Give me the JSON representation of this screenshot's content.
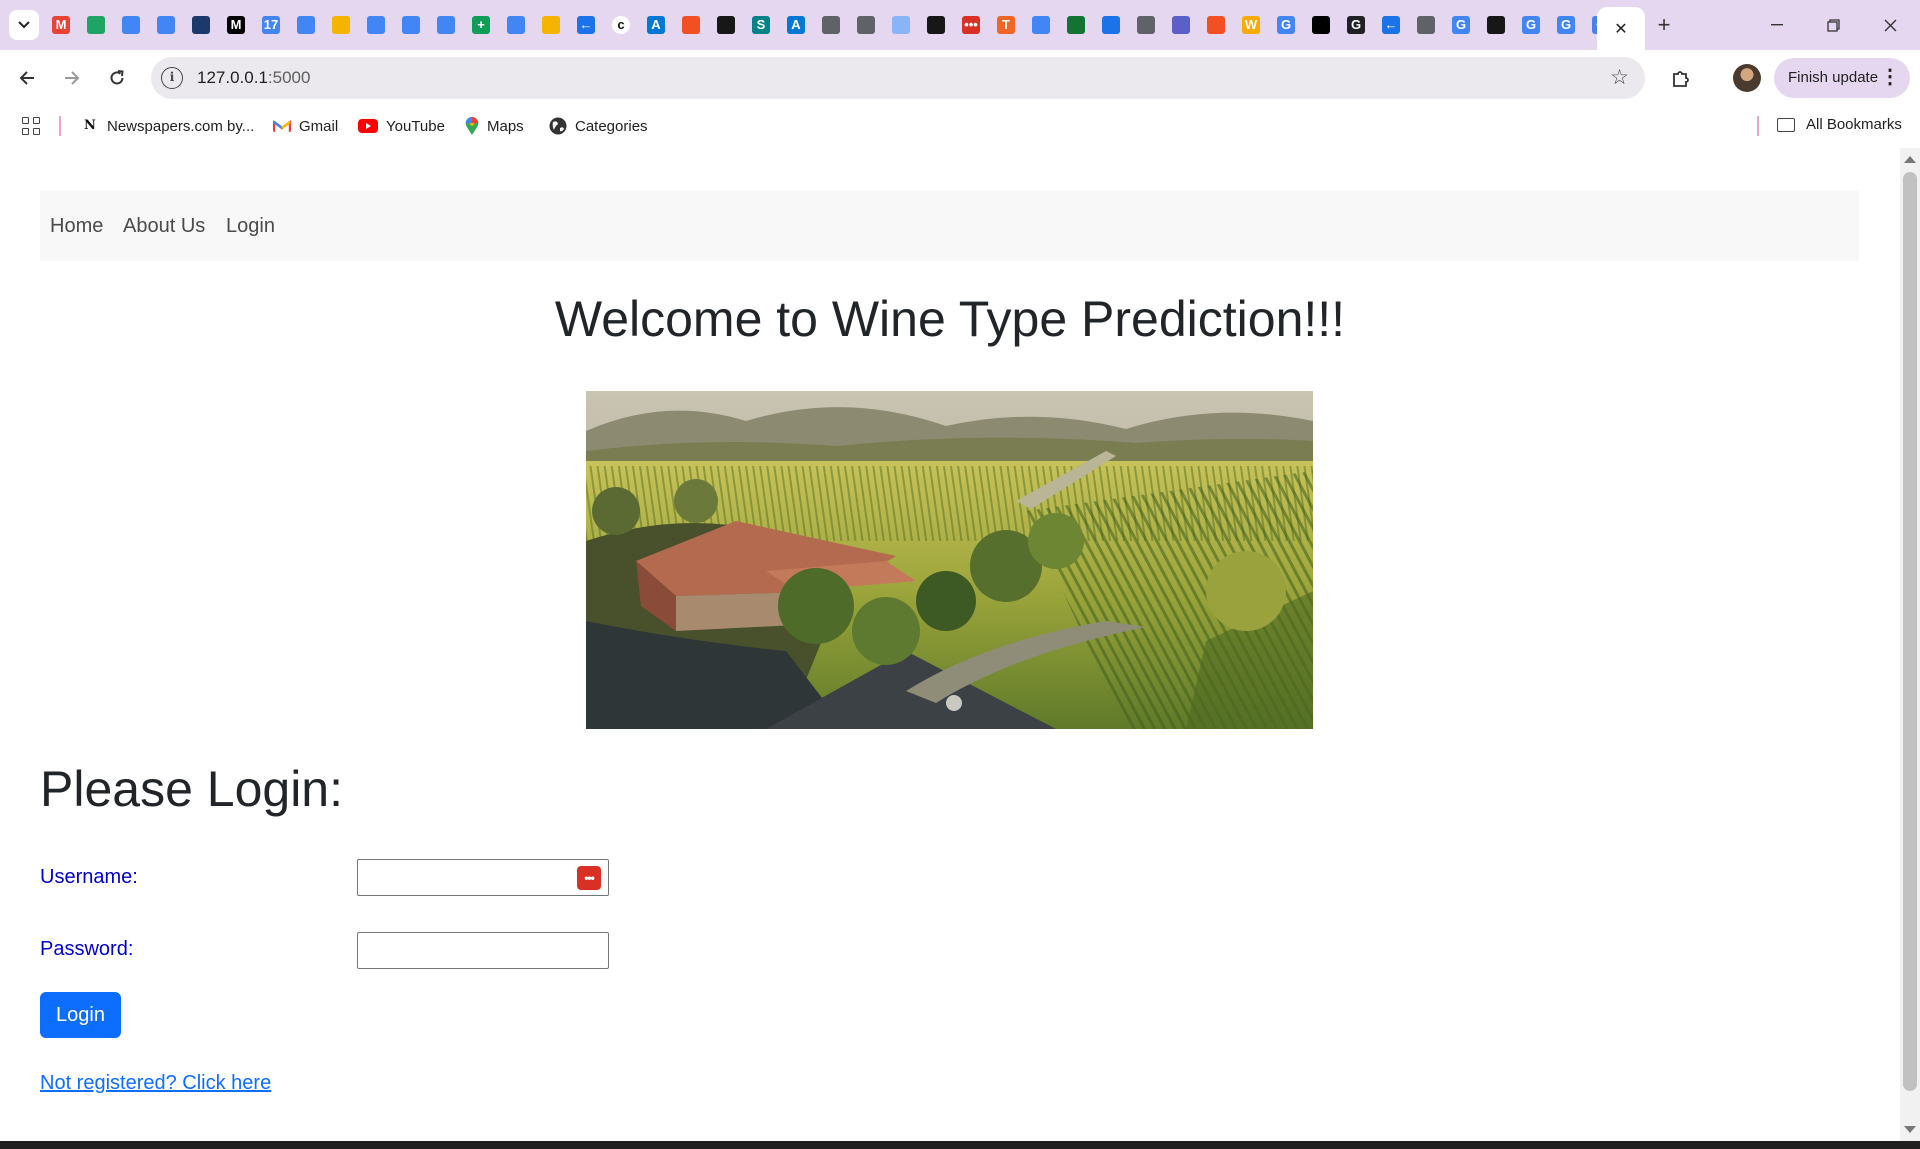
{
  "browser": {
    "tab_icons": [
      {
        "name": "gmail-favicon",
        "color": "#ea4335",
        "glyph": "M"
      },
      {
        "name": "google-drive-favicon",
        "color": "#1fa463",
        "glyph": ""
      },
      {
        "name": "google-docs-favicon",
        "color": "#4285f4",
        "glyph": ""
      },
      {
        "name": "google-docs-favicon",
        "color": "#4285f4",
        "glyph": ""
      },
      {
        "name": "chat-favicon",
        "color": "#1b3a6b",
        "glyph": ""
      },
      {
        "name": "medium-favicon",
        "color": "#000000",
        "glyph": "M"
      },
      {
        "name": "google-calendar-favicon",
        "color": "#4285f4",
        "glyph": "17"
      },
      {
        "name": "google-docs-favicon",
        "color": "#4285f4",
        "glyph": ""
      },
      {
        "name": "google-slides-favicon",
        "color": "#f4b400",
        "glyph": ""
      },
      {
        "name": "google-docs-favicon",
        "color": "#4285f4",
        "glyph": ""
      },
      {
        "name": "google-docs-favicon",
        "color": "#4285f4",
        "glyph": ""
      },
      {
        "name": "google-docs-favicon",
        "color": "#4285f4",
        "glyph": ""
      },
      {
        "name": "google-sheets-favicon",
        "color": "#0f9d58",
        "glyph": "+"
      },
      {
        "name": "google-docs-favicon",
        "color": "#4285f4",
        "glyph": ""
      },
      {
        "name": "google-slides-favicon",
        "color": "#f4b400",
        "glyph": ""
      },
      {
        "name": "arrow-favicon",
        "color": "#1a73e8",
        "glyph": "←"
      },
      {
        "name": "c-favicon",
        "color": "#ffffff",
        "glyph": "c"
      },
      {
        "name": "azure-favicon",
        "color": "#0078d4",
        "glyph": "A"
      },
      {
        "name": "microsoft-favicon",
        "color": "#f25022",
        "glyph": ""
      },
      {
        "name": "github-favicon",
        "color": "#181717",
        "glyph": ""
      },
      {
        "name": "sharepoint-favicon",
        "color": "#038387",
        "glyph": "S"
      },
      {
        "name": "azure-favicon",
        "color": "#0078d4",
        "glyph": "A"
      },
      {
        "name": "globe-favicon",
        "color": "#5f6368",
        "glyph": ""
      },
      {
        "name": "mail-favicon",
        "color": "#5f6368",
        "glyph": ""
      },
      {
        "name": "cloud-favicon",
        "color": "#8ab4f8",
        "glyph": ""
      },
      {
        "name": "github-favicon",
        "color": "#181717",
        "glyph": ""
      },
      {
        "name": "password-manager-favicon",
        "color": "#d93025",
        "glyph": "•••"
      },
      {
        "name": "t-favicon",
        "color": "#f26522",
        "glyph": "T"
      },
      {
        "name": "google-docs-favicon",
        "color": "#4285f4",
        "glyph": ""
      },
      {
        "name": "tree-favicon",
        "color": "#137333",
        "glyph": ""
      },
      {
        "name": "eye-favicon",
        "color": "#1a73e8",
        "glyph": ""
      },
      {
        "name": "globe-favicon",
        "color": "#5f6368",
        "glyph": ""
      },
      {
        "name": "teams-favicon",
        "color": "#5b5fc7",
        "glyph": ""
      },
      {
        "name": "microsoft-favicon",
        "color": "#f25022",
        "glyph": ""
      },
      {
        "name": "w-favicon",
        "color": "#f9ab00",
        "glyph": "W"
      },
      {
        "name": "google-favicon",
        "color": "#4285f4",
        "glyph": "G"
      },
      {
        "name": "vs-favicon",
        "color": "#000000",
        "glyph": ""
      },
      {
        "name": "g-favicon",
        "color": "#202124",
        "glyph": "G"
      },
      {
        "name": "arrow-favicon",
        "color": "#1a73e8",
        "glyph": "←"
      },
      {
        "name": "globe-favicon",
        "color": "#5f6368",
        "glyph": ""
      },
      {
        "name": "google-favicon",
        "color": "#4285f4",
        "glyph": "G"
      },
      {
        "name": "github-favicon",
        "color": "#181717",
        "glyph": ""
      },
      {
        "name": "google-favicon",
        "color": "#4285f4",
        "glyph": "G"
      },
      {
        "name": "google-favicon",
        "color": "#4285f4",
        "glyph": "G"
      },
      {
        "name": "gemini-favicon",
        "color": "#4a7ee8",
        "glyph": "✦"
      }
    ],
    "address": {
      "host": "127.0.0.1",
      "port": ":5000"
    },
    "update_button": "Finish update",
    "bookmarks": [
      {
        "label": "Newspapers.com by...",
        "icon": "newspapers-icon"
      },
      {
        "label": "Gmail",
        "icon": "gmail-icon"
      },
      {
        "label": "YouTube",
        "icon": "youtube-icon"
      },
      {
        "label": "Maps",
        "icon": "maps-icon"
      },
      {
        "label": "Categories",
        "icon": "globe-icon"
      }
    ],
    "all_bookmarks": "All Bookmarks"
  },
  "page": {
    "nav": {
      "home": "Home",
      "about": "About Us",
      "login": "Login"
    },
    "title": "Welcome to Wine Type Prediction!!!",
    "login_heading": "Please Login:",
    "username_label": "Username:",
    "password_label": "Password:",
    "username_value": "",
    "password_value": "",
    "login_button": "Login",
    "register_link": "Not registered? Click here"
  }
}
